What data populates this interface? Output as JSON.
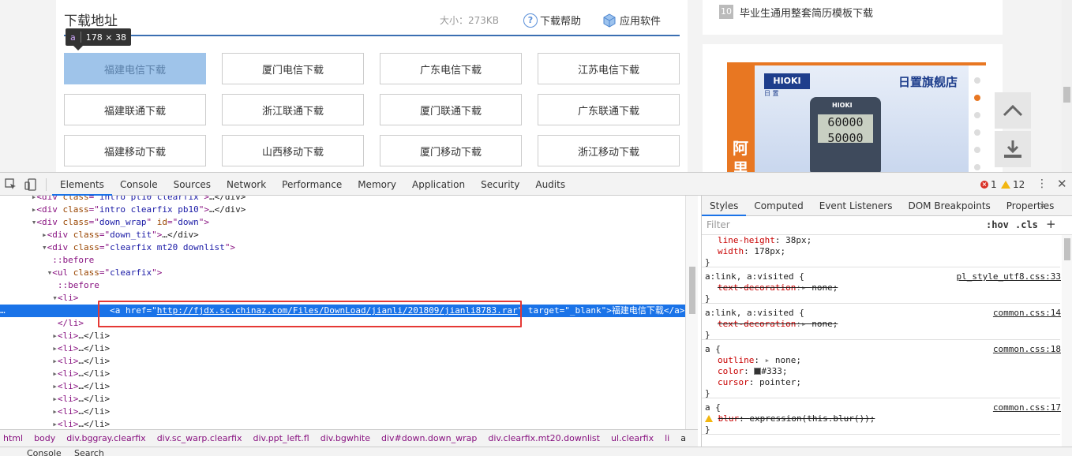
{
  "page": {
    "section_title": "下载地址",
    "file_size": "大小：273KB",
    "help_link": "下载帮助",
    "software_link": "应用软件",
    "tooltip": {
      "tag": "a",
      "size": "178 × 38"
    },
    "download_buttons": [
      "福建电信下载",
      "厦门电信下载",
      "广东电信下载",
      "江苏电信下载",
      "福建联通下载",
      "浙江联通下载",
      "厦门联通下载",
      "广东联通下载",
      "福建移动下载",
      "山西移动下载",
      "厦门移动下载",
      "浙江移动下载"
    ],
    "sidebar_rank": {
      "num": "10",
      "text": "毕业生通用整套简历模板下载"
    },
    "ad": {
      "brand": "HIOKI",
      "brand_sub": "日 置",
      "store": "日置旗舰店",
      "left_text": "阿\n里",
      "screen": "60000\n50000",
      "meter_brand": "HIOKI"
    }
  },
  "devtools": {
    "tabs": [
      "Elements",
      "Console",
      "Sources",
      "Network",
      "Performance",
      "Memory",
      "Application",
      "Security",
      "Audits"
    ],
    "errors": "1",
    "warnings": "12",
    "elements": [
      {
        "indent": 6,
        "tri": "▸",
        "tag": "div",
        "attrs": [
          [
            "class",
            "intro pt10 clearfix"
          ]
        ],
        "tail": "…</div>"
      },
      {
        "indent": 6,
        "tri": "▸",
        "tag": "div",
        "attrs": [
          [
            "class",
            "intro clearfix pb10"
          ]
        ],
        "tail": "…</div>"
      },
      {
        "indent": 6,
        "tri": "▾",
        "tag": "div",
        "attrs": [
          [
            "class",
            "down_wrap"
          ],
          [
            "id",
            "down"
          ]
        ],
        "tail": ""
      },
      {
        "indent": 8,
        "tri": "▸",
        "tag": "div",
        "attrs": [
          [
            "class",
            "down_tit"
          ]
        ],
        "tail": "…</div>"
      },
      {
        "indent": 8,
        "tri": "▾",
        "tag": "div",
        "attrs": [
          [
            "class",
            "clearfix mt20 downlist"
          ]
        ],
        "tail": ""
      },
      {
        "indent": 10,
        "pseudo": "::before"
      },
      {
        "indent": 8,
        "tri": "▾",
        "tag": "ul",
        "attrs": [
          [
            "class",
            "clearfix"
          ]
        ],
        "tail": "",
        "extra": 1
      },
      {
        "indent": 11,
        "pseudo": "::before"
      },
      {
        "indent": 10,
        "tri": "▾",
        "tag": "li",
        "attrs": [],
        "tail": ""
      },
      {
        "indent": 12,
        "selected": true,
        "tag": "a",
        "attrs": [
          [
            "href",
            "http://fjdx.sc.chinaz.com/Files/DownLoad/jianli/201809/jianli8783.rar"
          ],
          [
            "target",
            "_blank"
          ]
        ],
        "tail": "福建电信下载</a>"
      },
      {
        "indent": 11,
        "close": "</li>"
      },
      {
        "indent": 10,
        "tri": "▸",
        "tag": "li",
        "attrs": [],
        "tail": "…</li>"
      },
      {
        "indent": 10,
        "tri": "▸",
        "tag": "li",
        "attrs": [],
        "tail": "…</li>"
      },
      {
        "indent": 10,
        "tri": "▸",
        "tag": "li",
        "attrs": [],
        "tail": "…</li>"
      },
      {
        "indent": 10,
        "tri": "▸",
        "tag": "li",
        "attrs": [],
        "tail": "…</li>"
      },
      {
        "indent": 10,
        "tri": "▸",
        "tag": "li",
        "attrs": [],
        "tail": "…</li>"
      },
      {
        "indent": 10,
        "tri": "▸",
        "tag": "li",
        "attrs": [],
        "tail": "…</li>"
      },
      {
        "indent": 10,
        "tri": "▸",
        "tag": "li",
        "attrs": [],
        "tail": "…</li>"
      },
      {
        "indent": 10,
        "tri": "▸",
        "tag": "li",
        "attrs": [],
        "tail": "…</li>"
      }
    ],
    "breadcrumbs": [
      "html",
      "body",
      "div.bggray.clearfix",
      "div.sc_warp.clearfix",
      "div.ppt_left.fl",
      "div.bgwhite",
      "div#down.down_wrap",
      "div.clearfix.mt20.downlist",
      "ul.clearfix",
      "li",
      "a"
    ],
    "drawer": [
      "Console",
      "Search"
    ],
    "styles": {
      "tabs": [
        "Styles",
        "Computed",
        "Event Listeners",
        "DOM Breakpoints",
        "Properties"
      ],
      "filter_placeholder": "Filter",
      "hov": ":hov",
      "cls": ".cls",
      "rules": [
        {
          "selector": "",
          "source": "",
          "props": [
            [
              "line-height",
              "38px",
              false
            ],
            [
              "width",
              "178px",
              false
            ]
          ]
        },
        {
          "selector": "a:link, a:visited {",
          "source": "pl_style_utf8.css:33",
          "props": [
            [
              "text-decoration",
              "none",
              true
            ]
          ]
        },
        {
          "selector": "a:link, a:visited {",
          "source": "common.css:14",
          "props": [
            [
              "text-decoration",
              "none",
              true
            ]
          ]
        },
        {
          "selector": "a {",
          "source": "common.css:18",
          "props": [
            [
              "outline",
              "none",
              false
            ],
            [
              "color",
              "#333",
              false
            ],
            [
              "cursor",
              "pointer",
              false
            ]
          ]
        },
        {
          "selector": "a {",
          "source": "common.css:17",
          "props": [
            [
              "blur",
              "expression(this.blur())",
              true
            ]
          ]
        }
      ]
    }
  }
}
